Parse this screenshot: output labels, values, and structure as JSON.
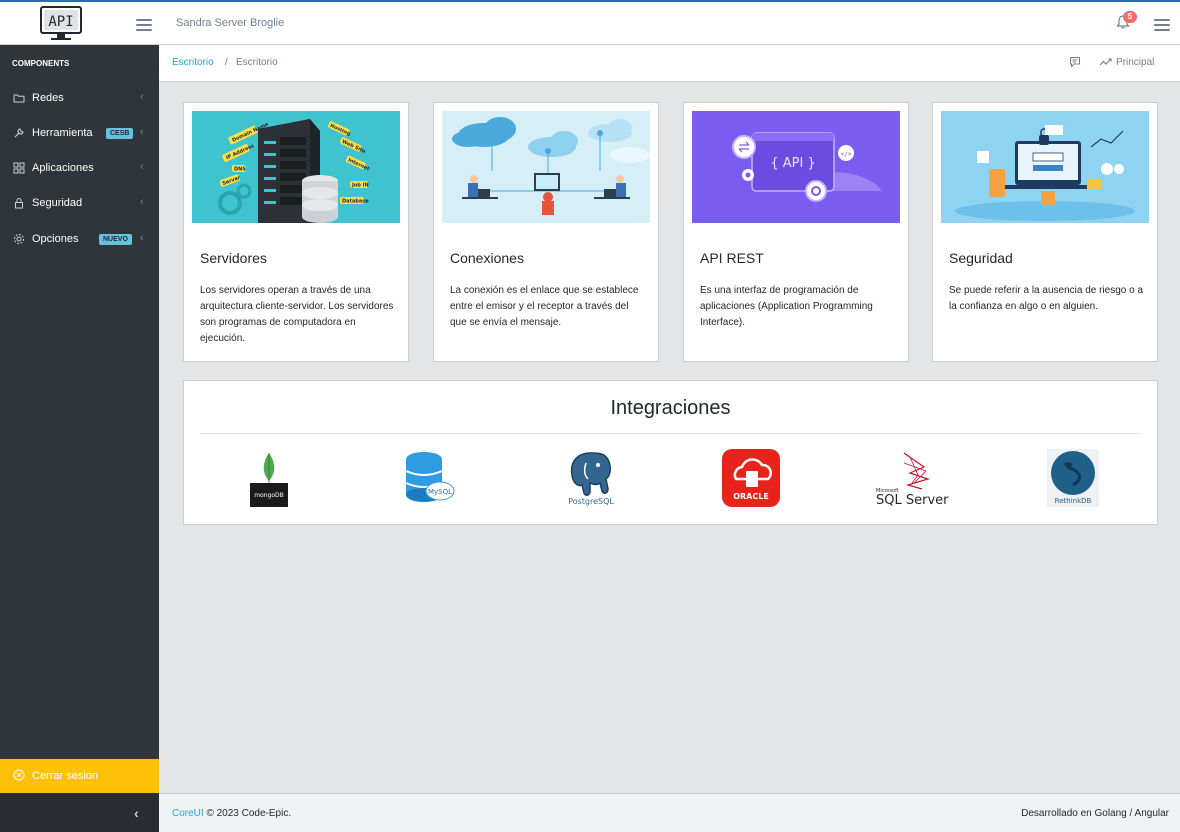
{
  "header": {
    "brand_text": "API",
    "user": "Sandra Server Broglie",
    "notifications_count": "5"
  },
  "sidebar": {
    "section_title": "COMPONENTS",
    "items": [
      {
        "label": "Redes",
        "icon": "folder-icon"
      },
      {
        "label": "Herramienta",
        "icon": "wrench-icon",
        "badge": "CESB"
      },
      {
        "label": "Aplicaciones",
        "icon": "grid-icon"
      },
      {
        "label": "Seguridad",
        "icon": "lock-icon"
      },
      {
        "label": "Opciones",
        "icon": "gear-icon",
        "badge": "NUEVO"
      }
    ],
    "logout_label": "Cerrar sesion"
  },
  "breadcrumb": {
    "home": "Escritorio",
    "separator": "/",
    "current": "Escritorio",
    "principal": "Principal"
  },
  "cards": [
    {
      "title": "Servidores",
      "text": "Los servidores operan a través de una arquitectura cliente-servidor. Los servidores son programas de computadora en ejecución.",
      "image": "server-illustration",
      "labels": [
        "Domain Name",
        "IP Address",
        "DNS",
        "Server",
        "Hosting",
        "Web Site",
        "Internet",
        "Job IN",
        "Database"
      ]
    },
    {
      "title": "Conexiones",
      "text": "La conexión es el enlace que se establece entre el emisor y el receptor a través del que se envía el mensaje.",
      "image": "cloud-connections-illustration"
    },
    {
      "title": "API REST",
      "text": "Es una interfaz de programación de aplicaciones (Application Programming Interface).",
      "image": "api-illustration",
      "image_text": "{ API }"
    },
    {
      "title": "Seguridad",
      "text": "Se puede referir a la ausencia de riesgo o a la confianza en algo o en alguien.",
      "image": "security-illustration"
    }
  ],
  "integrations": {
    "title": "Integraciones",
    "logos": [
      {
        "name": "mongodb-logo",
        "text": "mongoDB"
      },
      {
        "name": "mysql-logo",
        "text": "MySQL"
      },
      {
        "name": "postgresql-logo",
        "text": "PostgreSQL"
      },
      {
        "name": "oracle-logo",
        "text": "ORACLE"
      },
      {
        "name": "sqlserver-logo",
        "text": "SQL Server",
        "small": "Microsoft"
      },
      {
        "name": "rethinkdb-logo",
        "text": "RethinkDB"
      }
    ]
  },
  "footer": {
    "link": "CoreUI",
    "copyright": "© 2023 Code-Epic.",
    "right": "Desarrollado en Golang / Angular"
  },
  "colors": {
    "sidebar": "#2f353a",
    "accent": "#20a8d8",
    "logout": "#ffc107",
    "badge_info": "#63c2de",
    "badge_danger": "#f86c6b",
    "api_bg": "#7b5cf0",
    "cyan_bg": "#3ec3cf"
  }
}
